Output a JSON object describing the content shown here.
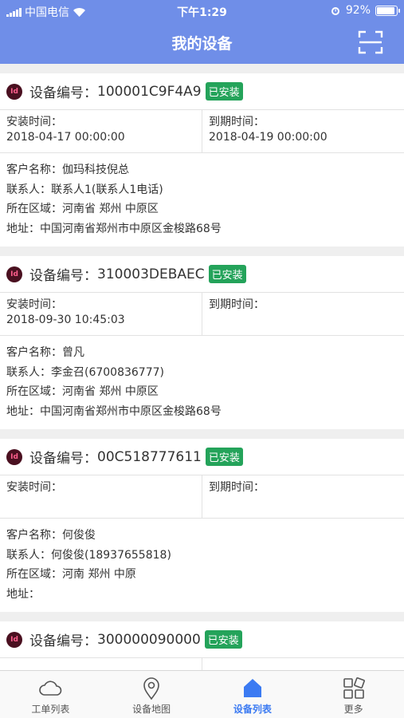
{
  "status_bar": {
    "carrier": "中国电信",
    "time": "下午1:29",
    "battery": "92%",
    "battery_level": 0.92
  },
  "header": {
    "title": "我的设备"
  },
  "devices": [
    {
      "no_label": "设备编号：",
      "no": "100001C9F4A9",
      "status": "已安装",
      "install_label": "安装时间：",
      "install_time": "2018-04-17 00:00:00",
      "expire_label": "到期时间：",
      "expire_time": "2018-04-19 00:00:00",
      "customer": "客户名称：伽玛科技倪总",
      "contact": "联系人：联系人1(联系人1电话)",
      "region": "所在区域：河南省 郑州 中原区",
      "address": "地址：中国河南省郑州市中原区金梭路68号"
    },
    {
      "no_label": "设备编号：",
      "no": "310003DEBAEC",
      "status": "已安装",
      "install_label": "安装时间：",
      "install_time": "2018-09-30 10:45:03",
      "expire_label": "到期时间：",
      "expire_time": "",
      "customer": "客户名称：曾凡",
      "contact": "联系人：李金召(6700836777)",
      "region": "所在区域：河南省 郑州 中原区",
      "address": "地址：中国河南省郑州市中原区金梭路68号"
    },
    {
      "no_label": "设备编号：",
      "no": "00C518777611",
      "status": "已安装",
      "install_label": "安装时间：",
      "install_time": "",
      "expire_label": "到期时间：",
      "expire_time": "",
      "customer": "客户名称：何俊俊",
      "contact": "联系人：何俊俊(18937655818)",
      "region": "所在区域：河南 郑州 中原",
      "address": "地址："
    },
    {
      "no_label": "设备编号：",
      "no": "300000090000",
      "status": "已安装"
    }
  ],
  "tabs": [
    {
      "label": "工单列表",
      "icon": "cloud-icon"
    },
    {
      "label": "设备地图",
      "icon": "location-pin-icon"
    },
    {
      "label": "设备列表",
      "icon": "home-icon",
      "active": true
    },
    {
      "label": "更多",
      "icon": "grid-icon"
    }
  ],
  "colors": {
    "header": "#6f8ee8",
    "badge": "#24a35a",
    "active_tab": "#3c7bf2"
  }
}
